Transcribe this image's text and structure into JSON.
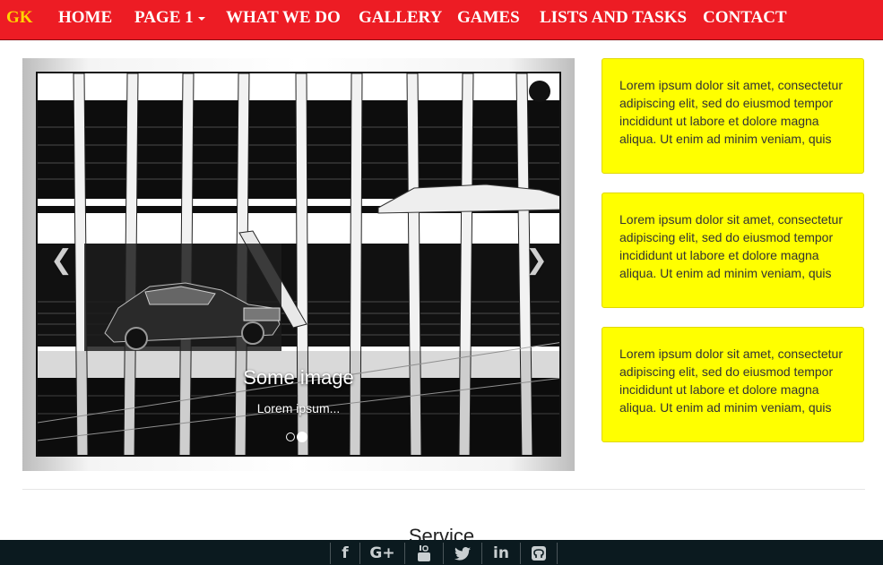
{
  "nav": {
    "brand": "GK",
    "items": [
      {
        "label": "HOME"
      },
      {
        "label": "PAGE 1",
        "has_dropdown": true
      },
      {
        "label": "WHAT WE DO"
      },
      {
        "label": "GALLERY"
      },
      {
        "label": "GAMES"
      },
      {
        "label": "LISTS AND TASKS"
      },
      {
        "label": "CONTACT"
      }
    ],
    "colors": {
      "bar": "#ed1c24",
      "brand": "#ffd400",
      "text": "#ffffff"
    }
  },
  "carousel": {
    "caption_title": "Some image",
    "caption_text": "Lorem ipsum...",
    "prev_icon": "chevron-left-icon",
    "next_icon": "chevron-right-icon",
    "slide_count": 2,
    "active_slide": 2
  },
  "boxes": [
    {
      "text": "Lorem ipsum dolor sit amet, consectetur adipiscing elit, sed do eiusmod tempor incididunt ut labore et dolore magna aliqua. Ut enim ad minim veniam, quis"
    },
    {
      "text": "Lorem ipsum dolor sit amet, consectetur adipiscing elit, sed do eiusmod tempor incididunt ut labore et dolore magna aliqua. Ut enim ad minim veniam, quis"
    },
    {
      "text": "Lorem ipsum dolor sit amet, consectetur adipiscing elit, sed do eiusmod tempor incididunt ut labore et dolore magna aliqua. Ut enim ad minim veniam, quis"
    }
  ],
  "box_color": "#ffff00",
  "section_title": "Service",
  "footer": {
    "background": "#0b1a1f",
    "social_icons": [
      "facebook-icon",
      "google-plus-icon",
      "youtube-icon",
      "twitter-icon",
      "linkedin-icon",
      "github-icon"
    ],
    "glyphs": {
      "facebook": "f",
      "google_plus": "G+",
      "linkedin": "in"
    }
  }
}
